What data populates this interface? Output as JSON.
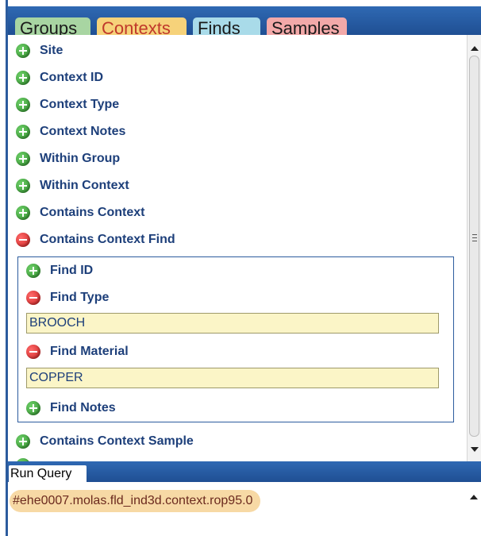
{
  "tabs": [
    {
      "label": "Groups"
    },
    {
      "label": "Contexts"
    },
    {
      "label": "Finds"
    },
    {
      "label": "Samples"
    }
  ],
  "active_tab": "Contexts",
  "criteria": [
    {
      "label": "Site",
      "state": "add"
    },
    {
      "label": "Context ID",
      "state": "add"
    },
    {
      "label": "Context Type",
      "state": "add"
    },
    {
      "label": "Context Notes",
      "state": "add"
    },
    {
      "label": "Within Group",
      "state": "add"
    },
    {
      "label": "Within Context",
      "state": "add"
    },
    {
      "label": "Contains Context",
      "state": "add"
    },
    {
      "label": "Contains Context Find",
      "state": "remove"
    }
  ],
  "sub_criteria": {
    "find_id": {
      "label": "Find ID",
      "state": "add"
    },
    "find_type": {
      "label": "Find Type",
      "state": "remove",
      "value": "BROOCH"
    },
    "find_material": {
      "label": "Find Material",
      "state": "remove",
      "value": "COPPER"
    },
    "find_notes": {
      "label": "Find Notes",
      "state": "add"
    }
  },
  "after_criteria": [
    {
      "label": "Contains Context Sample",
      "state": "add"
    }
  ],
  "run_query": {
    "label": "Run Query"
  },
  "result": {
    "text": "#ehe0007.molas.fld_ind3d.context.rop95.0"
  },
  "colors": {
    "bar_blue": "#2f69b3",
    "label_blue": "#1d3f7a",
    "field_bg": "#fbf5c7",
    "result_chip": "#f7d9a5",
    "add_green": "#2e8f2a",
    "remove_red": "#c81d1d"
  },
  "icons": {
    "add": "plus-circle-icon",
    "remove": "minus-circle-icon"
  }
}
